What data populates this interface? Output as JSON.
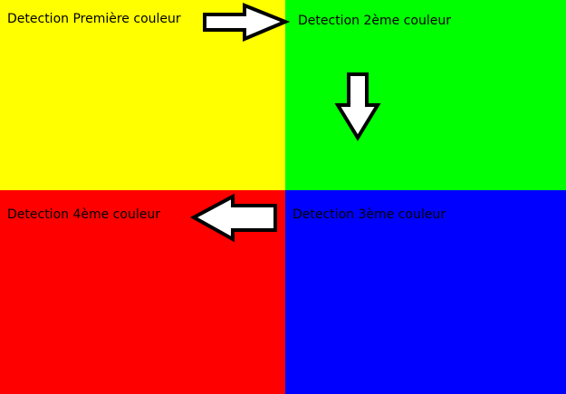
{
  "diagram": {
    "quadrants": [
      {
        "id": "q1",
        "label": "Detection Première couleur",
        "color": "#ffff00"
      },
      {
        "id": "q2",
        "label": "Detection 2ème couleur",
        "color": "#00ff00"
      },
      {
        "id": "q3",
        "label": "Detection 3ème couleur",
        "color": "#0000ff"
      },
      {
        "id": "q4",
        "label": "Detection 4ème couleur",
        "color": "#ff0000"
      }
    ],
    "arrows": [
      {
        "direction": "right",
        "from": "q1",
        "to": "q2"
      },
      {
        "direction": "down",
        "from": "q2",
        "to": "q3"
      },
      {
        "direction": "left",
        "from": "q3",
        "to": "q4"
      }
    ],
    "arrow_fill": "#ffffff",
    "arrow_stroke": "#000000"
  }
}
